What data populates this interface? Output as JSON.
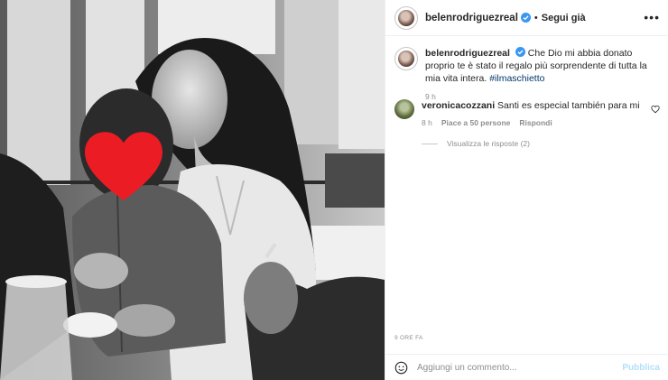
{
  "post": {
    "author": "belenrodriguezreal",
    "follow_label": "Segui già",
    "more_label": "•••",
    "caption": "Che Dio mi abbia donato proprio te è stato il regalo più sorprendente di tutta la mia vita intera.",
    "hashtag": "#ilmaschietto",
    "caption_time": "9 h",
    "posted_time": "9 ORE FA"
  },
  "comments": [
    {
      "author": "veronicacozzani",
      "text": "Santi es especial también para mi",
      "time": "8 h",
      "likes": "Piace a 50 persone",
      "reply_label": "Rispondi",
      "view_replies": "Visualizza le risposte (2)"
    }
  ],
  "composer": {
    "placeholder": "Aggiungi un commento...",
    "publish_label": "Pubblica"
  },
  "colors": {
    "verified_blue": "#3897f0",
    "link_blue": "#00376b",
    "publish_disabled": "#b2dffc",
    "heart_red": "#ec1c24"
  }
}
